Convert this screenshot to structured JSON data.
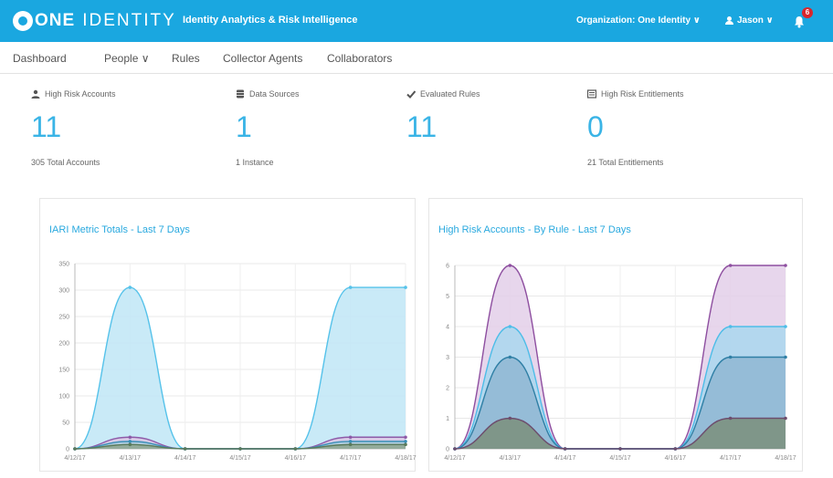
{
  "header": {
    "logo_one": "ONE",
    "logo_identity": "IDENTITY",
    "app_title": "Identity Analytics & Risk Intelligence",
    "organization": "Organization: One Identity ∨",
    "user": "Jason ∨",
    "notification_count": "6"
  },
  "nav": {
    "items": [
      "Dashboard",
      "People ∨",
      "Rules",
      "Collector Agents",
      "Collaborators"
    ]
  },
  "stats": [
    {
      "label": "High Risk Accounts",
      "value": "11",
      "sub": "305 Total Accounts",
      "icon": "user-icon"
    },
    {
      "label": "Data Sources",
      "value": "1",
      "sub": "1 Instance",
      "icon": "database-icon"
    },
    {
      "label": "Evaluated Rules",
      "value": "11",
      "sub": "",
      "icon": "check-icon"
    },
    {
      "label": "High Risk Entitlements",
      "value": "0",
      "sub": "21 Total Entitlements",
      "icon": "list-icon"
    }
  ],
  "colors": {
    "brand": "#1aa7e0",
    "stat_value": "#3ab4e6",
    "badge": "#d9262c"
  },
  "chart_data": [
    {
      "type": "area",
      "title": "IARI Metric Totals - Last 7 Days",
      "x": [
        "4/12/17",
        "4/13/17",
        "4/14/17",
        "4/15/17",
        "4/16/17",
        "4/17/17",
        "4/18/17"
      ],
      "ylim": [
        0,
        350
      ],
      "yticks": [
        0,
        50,
        100,
        150,
        200,
        250,
        300,
        350
      ],
      "grid": true,
      "series": [
        {
          "values": [
            0,
            305,
            0,
            0,
            0,
            305,
            305
          ],
          "color": "#55c2ea",
          "fill": "#bfe6f6"
        },
        {
          "values": [
            0,
            22,
            0,
            0,
            0,
            22,
            22
          ],
          "color": "#8e5aa8",
          "fill": "#d9c5e4"
        },
        {
          "values": [
            0,
            14,
            0,
            0,
            0,
            14,
            14
          ],
          "color": "#3a8fb7",
          "fill": "#a9cfe0"
        },
        {
          "values": [
            0,
            8,
            0,
            0,
            0,
            8,
            8
          ],
          "color": "#5a7a5a",
          "fill": "#8ea58e"
        }
      ]
    },
    {
      "type": "area",
      "title": "High Risk Accounts - By Rule - Last 7 Days",
      "x": [
        "4/12/17",
        "4/13/17",
        "4/14/17",
        "4/15/17",
        "4/16/17",
        "4/17/17",
        "4/18/17"
      ],
      "ylim": [
        0,
        6
      ],
      "yticks": [
        0,
        1,
        2,
        3,
        4,
        5,
        6
      ],
      "grid": true,
      "series": [
        {
          "values": [
            0,
            6,
            0,
            0,
            0,
            6,
            6
          ],
          "color": "#8e4fa0",
          "fill": "#e3cfe9"
        },
        {
          "values": [
            0,
            4,
            0,
            0,
            0,
            4,
            4
          ],
          "color": "#4dbde8",
          "fill": "#a9d7ee"
        },
        {
          "values": [
            0,
            3,
            0,
            0,
            0,
            3,
            3
          ],
          "color": "#2f7fa5",
          "fill": "#8fb7d2"
        },
        {
          "values": [
            0,
            1,
            0,
            0,
            0,
            1,
            1
          ],
          "color": "#6d4d6d",
          "fill": "#7b8f7b"
        }
      ]
    }
  ]
}
